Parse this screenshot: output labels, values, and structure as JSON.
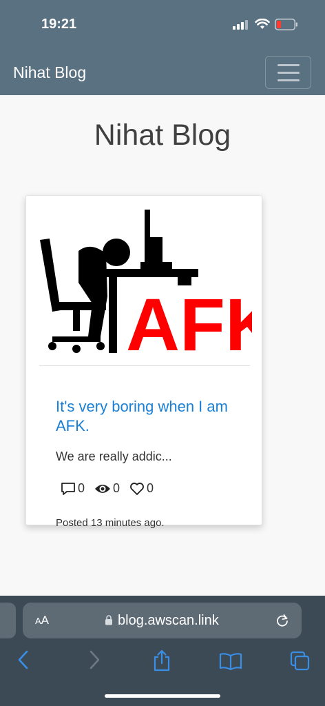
{
  "status": {
    "time": "19:21"
  },
  "navbar": {
    "brand": "Nihat Blog"
  },
  "page": {
    "heading": "Nihat Blog"
  },
  "post": {
    "image_text": "AFK",
    "title": "It's very boring when I am AFK.",
    "excerpt": "We are really addic...",
    "comments": "0",
    "views": "0",
    "likes": "0",
    "posted": "Posted 13 minutes ago."
  },
  "browser": {
    "aa_small": "A",
    "aa_large": "A",
    "url": "blog.awscan.link"
  },
  "colors": {
    "header_bg": "#5a7182",
    "link": "#1a7fd4",
    "browser_bg": "#3b4a55",
    "accent_icon": "#3a8ee6",
    "afk_red": "#ff0000"
  },
  "icons": [
    "signal-icon",
    "wifi-icon",
    "battery-icon",
    "hamburger-icon",
    "comment-icon",
    "eye-icon",
    "heart-icon",
    "lock-icon",
    "reload-icon",
    "back-icon",
    "forward-icon",
    "share-icon",
    "bookmarks-icon",
    "tabs-icon"
  ]
}
